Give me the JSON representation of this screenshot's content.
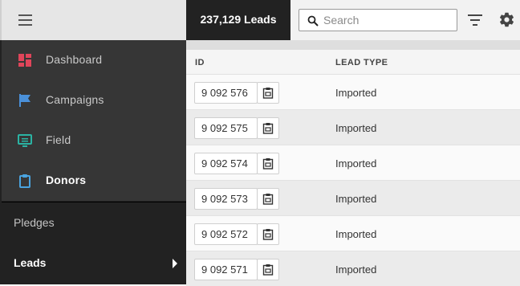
{
  "sidebar": {
    "nav_items": [
      {
        "label": "Dashboard",
        "icon": "dashboard-icon"
      },
      {
        "label": "Campaigns",
        "icon": "flag-icon"
      },
      {
        "label": "Field",
        "icon": "monitor-icon"
      },
      {
        "label": "Donors",
        "icon": "clipboard-icon"
      }
    ],
    "sub_items": [
      {
        "label": "Pledges"
      },
      {
        "label": "Leads"
      }
    ]
  },
  "header": {
    "count_label": "237,129 Leads"
  },
  "search": {
    "placeholder": "Search",
    "value": ""
  },
  "table": {
    "columns": [
      "ID",
      "LEAD TYPE"
    ],
    "rows": [
      {
        "id": "9 092 576",
        "lead_type": "Imported"
      },
      {
        "id": "9 092 575",
        "lead_type": "Imported"
      },
      {
        "id": "9 092 574",
        "lead_type": "Imported"
      },
      {
        "id": "9 092 573",
        "lead_type": "Imported"
      },
      {
        "id": "9 092 572",
        "lead_type": "Imported"
      },
      {
        "id": "9 092 571",
        "lead_type": "Imported"
      }
    ]
  },
  "colors": {
    "dashboard_icon": "#e0455a",
    "campaigns_icon": "#4a90d9",
    "field_icon": "#2bb3a3",
    "donors_icon": "#4aa3df",
    "sidebar_bg": "#222222",
    "sidebar_nav_bg": "#363636"
  }
}
